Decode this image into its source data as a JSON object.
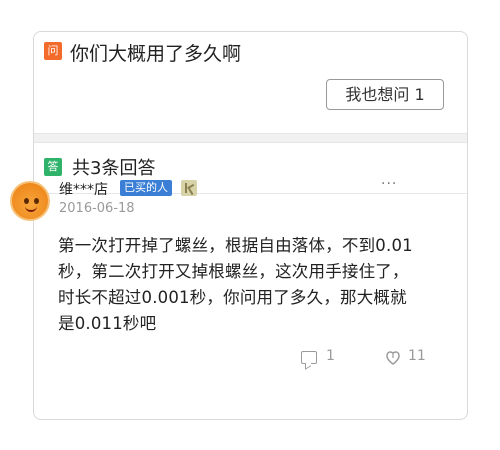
{
  "question": {
    "badge": "问",
    "title": "你们大概用了多久啊",
    "me_too_label": "我也想问 1"
  },
  "answers_header": {
    "badge": "答",
    "count_label": "共3条回答"
  },
  "answer": {
    "username": "维***店",
    "buyer_tag": "已买的人",
    "date": "2016-06-18",
    "more": "···",
    "text": "第一次打开掉了螺丝，根据自由落体，不到0.01秒，第二次打开又掉根螺丝，这次用手接住了，时长不超过0.001秒，你问用了多久，那大概就是0.011秒吧",
    "comment_count": "1",
    "like_count": "11"
  },
  "colors": {
    "question_badge": "#f26b2a",
    "answer_badge": "#2fb36a",
    "buyer_tag": "#3a7fd5"
  }
}
